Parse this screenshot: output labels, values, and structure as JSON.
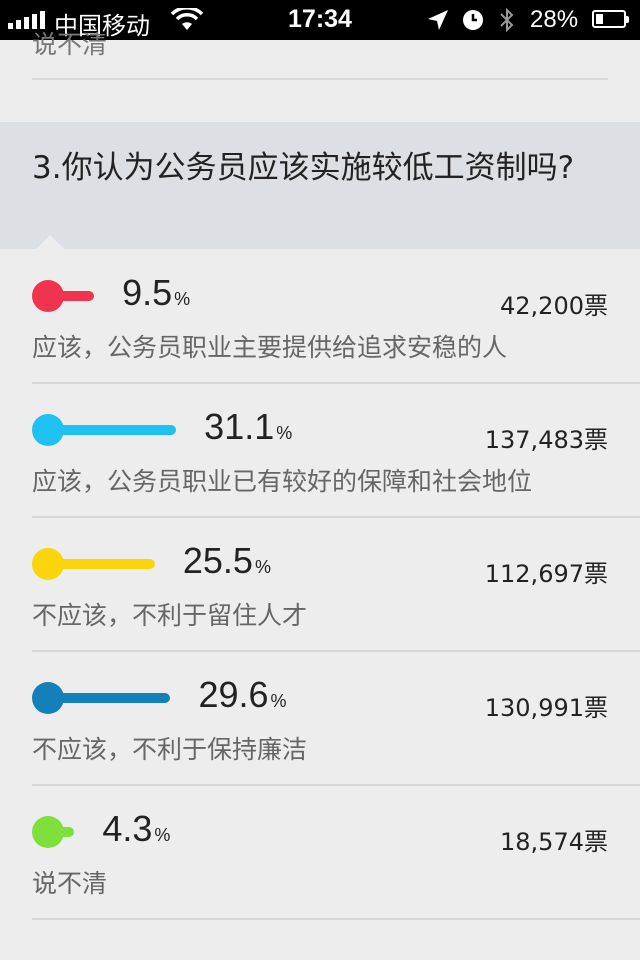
{
  "status_bar": {
    "carrier": "中国移动",
    "time": "17:34",
    "battery_percent": "28%",
    "battery_level": 0.28
  },
  "previous_answer": {
    "label": "说不清"
  },
  "question": {
    "text": "3.你认为公务员应该实施较低工资制吗?"
  },
  "options": [
    {
      "percent": "9.5",
      "percent_sign": "%",
      "votes": "42,200票",
      "label": "应该，公务员职业主要提供给追求安稳的人",
      "color": "#f0344f",
      "value": 9.5
    },
    {
      "percent": "31.1",
      "percent_sign": "%",
      "votes": "137,483票",
      "label": "应该，公务员职业已有较好的保障和社会地位",
      "color": "#1fc1f2",
      "value": 31.1
    },
    {
      "percent": "25.5",
      "percent_sign": "%",
      "votes": "112,697票",
      "label": "不应该，不利于留住人才",
      "color": "#fbd50b",
      "value": 25.5
    },
    {
      "percent": "29.6",
      "percent_sign": "%",
      "votes": "130,991票",
      "label": "不应该，不利于保持廉洁",
      "color": "#1380b9",
      "value": 29.6
    },
    {
      "percent": "4.3",
      "percent_sign": "%",
      "votes": "18,574票",
      "label": "说不清",
      "color": "#7ee03a",
      "value": 4.3
    }
  ]
}
